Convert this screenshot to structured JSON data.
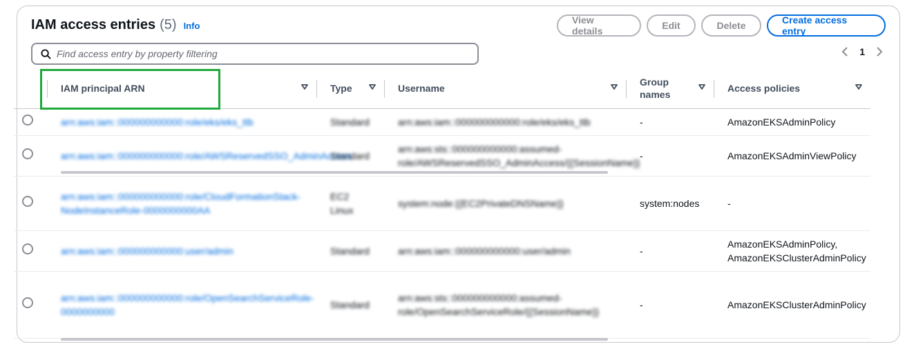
{
  "header": {
    "title": "IAM access entries",
    "count": "(5)",
    "info": "Info"
  },
  "actions": {
    "view_details": "View details",
    "edit": "Edit",
    "delete": "Delete",
    "create": "Create access entry"
  },
  "search": {
    "placeholder": "Find access entry by property filtering",
    "icon": "search-icon"
  },
  "pagination": {
    "page": "1",
    "prev_icon": "chevron-left-icon",
    "next_icon": "chevron-right-icon"
  },
  "columns": {
    "arn": "IAM principal ARN",
    "type": "Type",
    "username": "Username",
    "groups_line1": "Group",
    "groups_line2": "names",
    "policies": "Access policies"
  },
  "rows": [
    {
      "arn": "arn:aws:iam::000000000000:role/eks/eks_ttb",
      "type": "Standard",
      "username": "arn:aws:iam::000000000000:role/eks/eks_ttb",
      "groups": "-",
      "policies": "AmazonEKSAdminPolicy"
    },
    {
      "arn": "arn:aws:iam::000000000000:role/AWSReservedSSO_AdminAccess",
      "type": "Standard",
      "username": "arn:aws:sts::000000000000:assumed-role/AWSReservedSSO_AdminAccess/{{SessionName}}",
      "groups": "-",
      "policies": "AmazonEKSAdminViewPolicy"
    },
    {
      "arn": "arn:aws:iam::000000000000:role/CloudFormationStack-NodeInstanceRole-0000000000AA",
      "type": "EC2 Linux",
      "username": "system:node:{{EC2PrivateDNSName}}",
      "groups": "system:nodes",
      "policies": "-"
    },
    {
      "arn": "arn:aws:iam::000000000000:user/admin",
      "type": "Standard",
      "username": "arn:aws:iam::000000000000:user/admin",
      "groups": "-",
      "policies": "AmazonEKSAdminPolicy, AmazonEKSClusterAdminPolicy"
    },
    {
      "arn": "arn:aws:iam::000000000000:role/OpenSearchServiceRole-0000000000",
      "type": "Standard",
      "username": "arn:aws:sts::000000000000:assumed-role/OpenSearchServiceRole/{{SessionName}}",
      "groups": "-",
      "policies": "AmazonEKSClusterAdminPolicy"
    }
  ]
}
